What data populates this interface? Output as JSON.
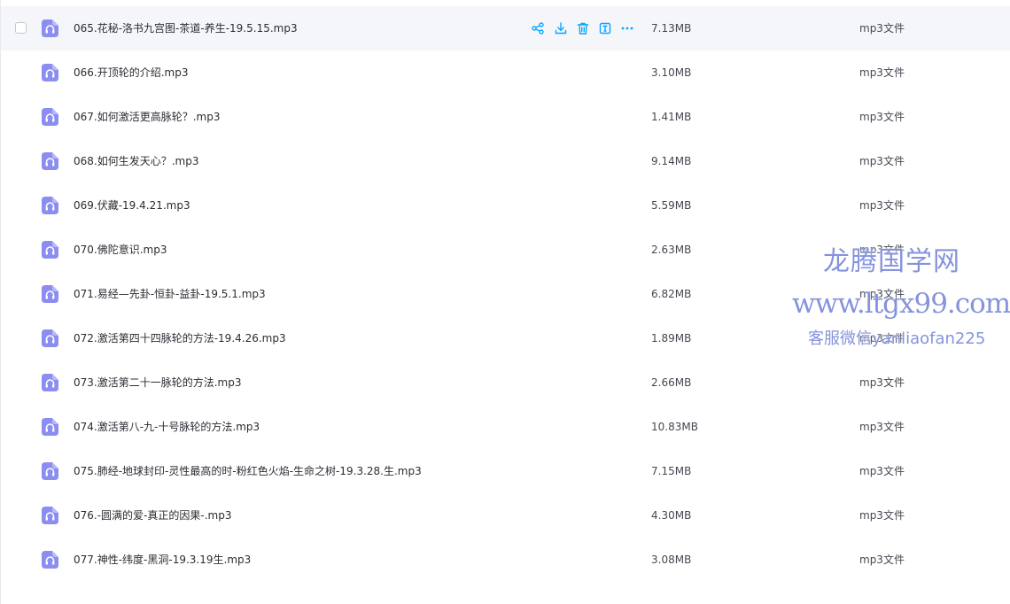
{
  "file_list": {
    "hovered_row": 0,
    "row_actions": [
      {
        "name": "share",
        "icon": "share-icon"
      },
      {
        "name": "download",
        "icon": "download-icon"
      },
      {
        "name": "delete",
        "icon": "trash-icon"
      },
      {
        "name": "text",
        "icon": "text-icon"
      },
      {
        "name": "more",
        "icon": "more-icon"
      }
    ],
    "rows": [
      {
        "name": "065.花秘-洛书九宫图-茶道-养生-19.5.15.mp3",
        "size": "7.13MB",
        "type": "mp3文件"
      },
      {
        "name": "066.开顶轮的介绍.mp3",
        "size": "3.10MB",
        "type": "mp3文件"
      },
      {
        "name": "067.如何激活更高脉轮？.mp3",
        "size": "1.41MB",
        "type": "mp3文件"
      },
      {
        "name": "068.如何生发天心？.mp3",
        "size": "9.14MB",
        "type": "mp3文件"
      },
      {
        "name": "069.伏藏-19.4.21.mp3",
        "size": "5.59MB",
        "type": "mp3文件"
      },
      {
        "name": "070.佛陀意识.mp3",
        "size": "2.63MB",
        "type": "mp3文件"
      },
      {
        "name": "071.易经—先卦-恒卦-益卦-19.5.1.mp3",
        "size": "6.82MB",
        "type": "mp3文件"
      },
      {
        "name": "072.激活第四十四脉轮的方法-19.4.26.mp3",
        "size": "1.89MB",
        "type": "mp3文件"
      },
      {
        "name": "073.激活第二十一脉轮的方法.mp3",
        "size": "2.66MB",
        "type": "mp3文件"
      },
      {
        "name": "074.激活第八-九-十号脉轮的方法.mp3",
        "size": "10.83MB",
        "type": "mp3文件"
      },
      {
        "name": "075.肺经-地球封印-灵性最高的时-粉红色火焰-生命之树-19.3.28.生.mp3",
        "size": "7.15MB",
        "type": "mp3文件"
      },
      {
        "name": "076.-圆满的爱-真正的因果-.mp3",
        "size": "4.30MB",
        "type": "mp3文件"
      },
      {
        "name": "077.神性-纬度-黑洞-19.3.19生.mp3",
        "size": "3.08MB",
        "type": "mp3文件"
      }
    ]
  },
  "watermark": {
    "title": "龙腾国学网",
    "url": "www.ltgx99.com",
    "contact": "客服微信yanliaofan225"
  },
  "colors": {
    "file_icon": "#8b8ef0",
    "action_icon": "#06a7ff",
    "hover_row_bg": "#f5f6fa",
    "watermark": "#8593dc"
  }
}
